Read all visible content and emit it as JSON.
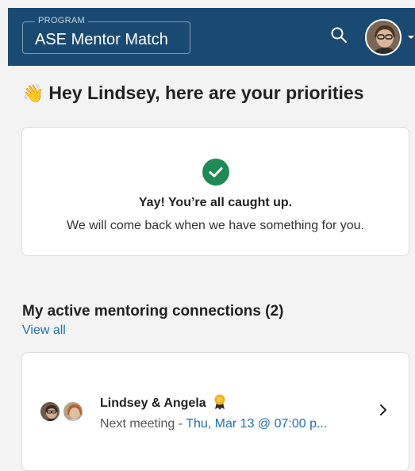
{
  "header": {
    "program_label": "PROGRAM",
    "program_name": "ASE Mentor Match",
    "search_icon": "search-icon",
    "avatar_icon": "user-avatar",
    "menu_icon": "chevron-down-icon"
  },
  "greeting": {
    "emoji": "👋",
    "text": "Hey Lindsey, here are your priorities"
  },
  "priorities": {
    "status_icon": "check-circle-icon",
    "title": "Yay! You’re all caught up.",
    "subtitle": "We will come back when we have something for you."
  },
  "connections": {
    "title": "My active mentoring connections (2)",
    "view_all": "View all",
    "items": [
      {
        "name": "Lindsey & Angela",
        "badge_icon": "award-ribbon-icon",
        "meeting_prefix": "Next meeting - ",
        "meeting_value": "Thu, Mar 13 @ 07:00 p..."
      }
    ]
  },
  "colors": {
    "header_bg": "#1a4a72",
    "accent_link": "#1f6fb2",
    "success": "#1e8a54",
    "badge": "#f2b01e"
  }
}
